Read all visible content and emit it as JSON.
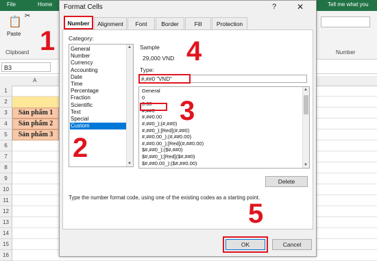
{
  "excel": {
    "tabs": [
      "File",
      "Home"
    ],
    "tell_me": "Tell me what you",
    "paste_label": "Paste",
    "clipboard_label": "Clipboard",
    "number_group_label": "Number",
    "name_box": "B3",
    "column_a": "A",
    "rows": [
      "1",
      "2",
      "3",
      "4",
      "5",
      "6",
      "7",
      "8",
      "9",
      "10",
      "11",
      "12",
      "13",
      "14",
      "15",
      "16"
    ],
    "products": [
      "Sản phẩm 1",
      "Sản phẩm 2",
      "Sản phẩm 3"
    ]
  },
  "dialog": {
    "title": "Format Cells",
    "help": "?",
    "close": "✕",
    "tabs": [
      "Number",
      "Alignment",
      "Font",
      "Border",
      "Fill",
      "Protection"
    ],
    "active_tab": "Number",
    "category_label": "Category:",
    "categories": [
      "General",
      "Number",
      "Currency",
      "Accounting",
      "Date",
      "Time",
      "Percentage",
      "Fraction",
      "Scientific",
      "Text",
      "Special",
      "Custom"
    ],
    "selected_category": "Custom",
    "sample_label": "Sample",
    "sample_value": "29,000 VND",
    "type_label": "Type:",
    "type_value": "#,##0 \"VND\"",
    "format_codes": [
      "General",
      "0",
      "0.00",
      "#,##0",
      "#,##0.00",
      "#,##0_);(#,##0)",
      "#,##0_);[Red](#,##0)",
      "#,##0.00_);(#,##0.00)",
      "#,##0.00_);[Red](#,##0.00)",
      "$#,##0_);($#,##0)",
      "$#,##0_);[Red]($#,##0)",
      "$#,##0.00_);($#,##0.00)"
    ],
    "delete_label": "Delete",
    "hint": "Type the number format code, using one of the existing codes as a starting point.",
    "ok_label": "OK",
    "cancel_label": "Cancel"
  },
  "steps": [
    "1",
    "2",
    "3",
    "4",
    "5"
  ],
  "colors": {
    "accent_red": "#e0141e",
    "excel_green": "#217346",
    "selection_blue": "#0078d7",
    "product_fill": "#f8c8a8",
    "header_fill": "#ffe79a"
  }
}
